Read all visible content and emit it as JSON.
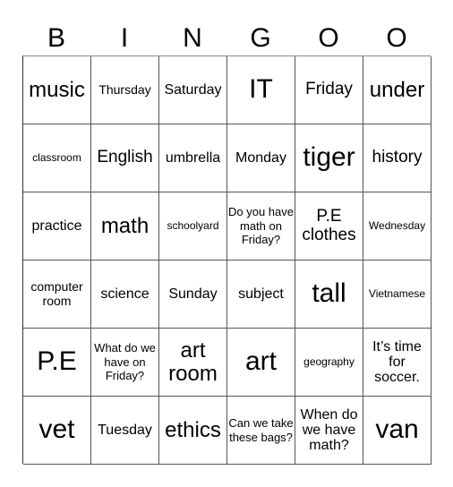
{
  "header": [
    "B",
    "I",
    "N",
    "G",
    "O",
    "O"
  ],
  "cells": [
    [
      "music",
      "Thursday",
      "Saturday",
      "IT",
      "Friday",
      "under"
    ],
    [
      "classroom",
      "English",
      "umbrella",
      "Monday",
      "tiger",
      "history"
    ],
    [
      "practice",
      "math",
      "schoolyard",
      "Do you have math on Friday?",
      "P.E clothes",
      "Wednesday"
    ],
    [
      "computer room",
      "science",
      "Sunday",
      "subject",
      "tall",
      "Vietnamese"
    ],
    [
      "P.E",
      "What do we have on Friday?",
      "art room",
      "art",
      "geography",
      "It’s time for soccer."
    ],
    [
      "vet",
      "Tuesday",
      "ethics",
      "Can we take these bags?",
      "When do we have math?",
      "van"
    ]
  ]
}
